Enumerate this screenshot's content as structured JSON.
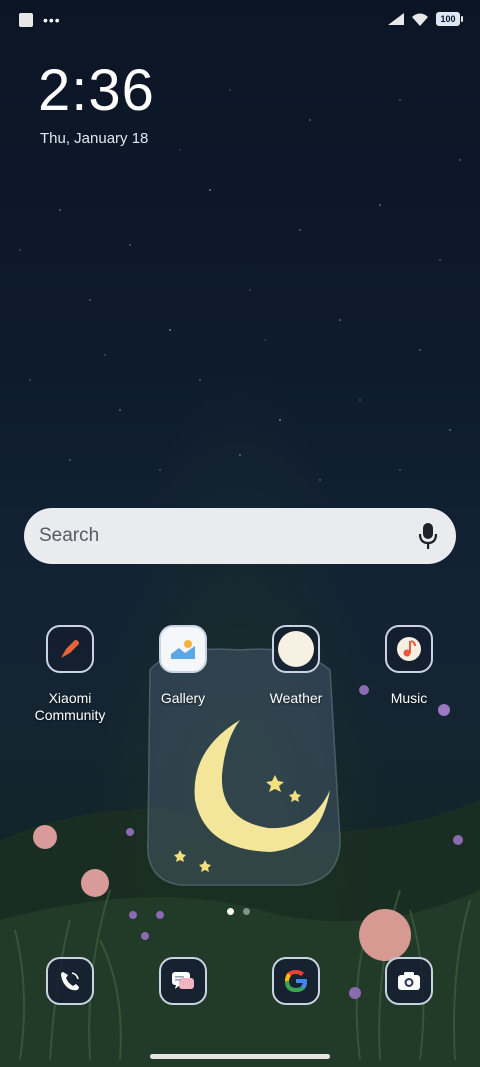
{
  "status_bar": {
    "battery": "100"
  },
  "lock": {
    "time": "2:36",
    "date": "Thu, January 18"
  },
  "search": {
    "placeholder": "Search"
  },
  "apps": [
    {
      "label": "Xiaomi\nCommunity",
      "icon": "xiaomi-community-icon"
    },
    {
      "label": "Gallery",
      "icon": "gallery-icon"
    },
    {
      "label": "Weather",
      "icon": "weather-icon"
    },
    {
      "label": "Music",
      "icon": "music-icon"
    }
  ],
  "dock": [
    {
      "icon": "phone-icon"
    },
    {
      "icon": "messages-icon"
    },
    {
      "icon": "google-icon"
    },
    {
      "icon": "camera-icon"
    }
  ],
  "pager": {
    "pages": 2,
    "current": 1
  }
}
